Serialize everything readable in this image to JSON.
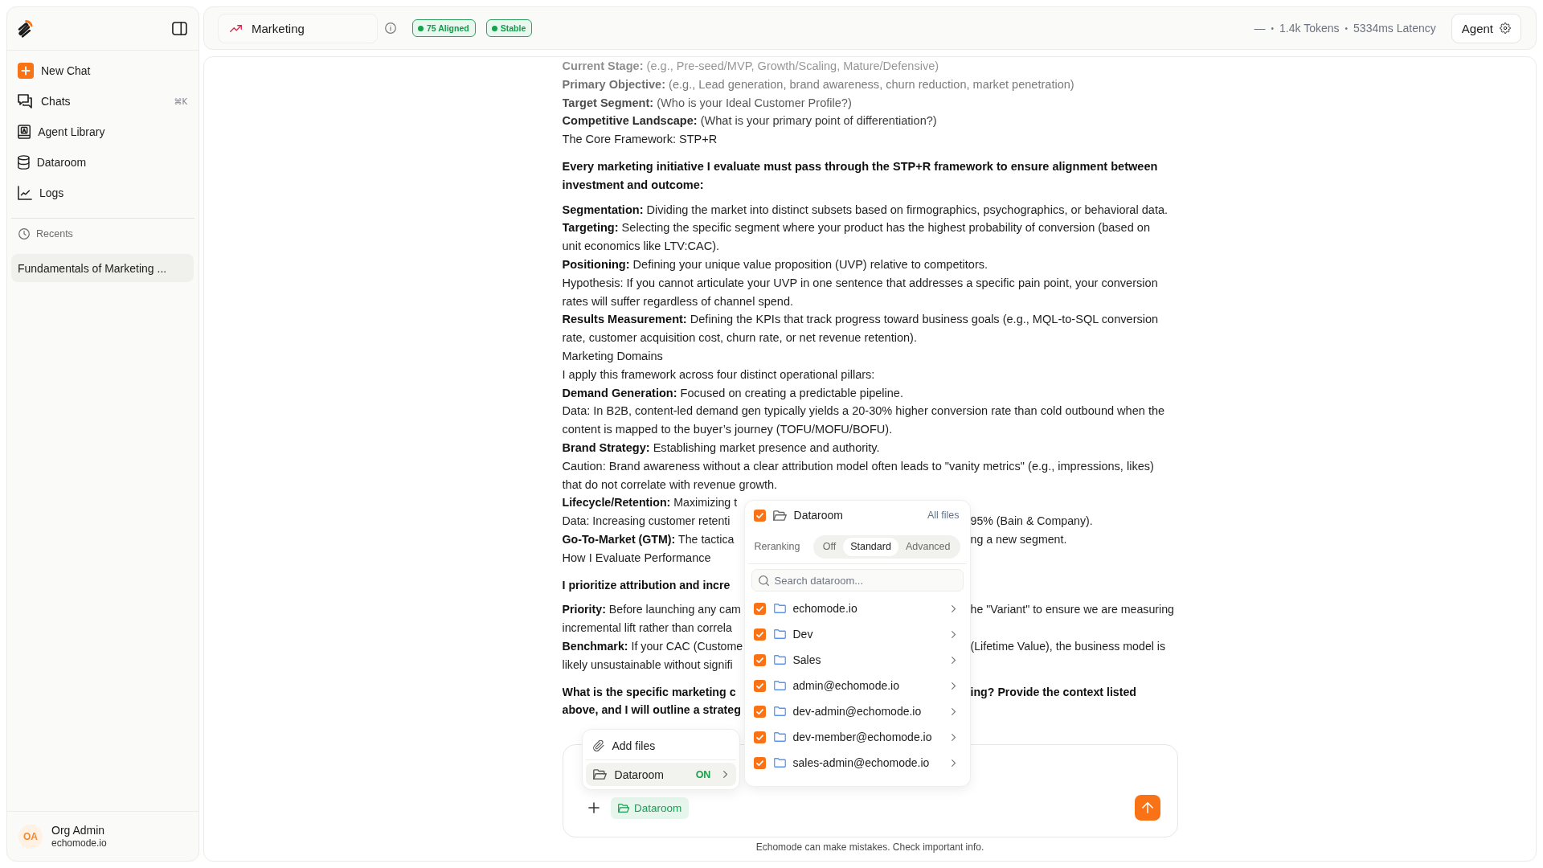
{
  "sidebar": {
    "nav_items": [
      {
        "kind": "new",
        "label": "New Chat"
      },
      {
        "kind": "chats",
        "label": "Chats",
        "shortcut": "⌘K"
      },
      {
        "kind": "library",
        "label": "Agent Library"
      },
      {
        "kind": "dataroom",
        "label": "Dataroom"
      },
      {
        "kind": "logs",
        "label": "Logs"
      }
    ],
    "recents_label": "Recents",
    "recents": [
      {
        "title": "Fundamentals of Marketing ...",
        "selected": true
      }
    ],
    "user": {
      "initials": "OA",
      "name": "Org Admin",
      "email": "echomode.io"
    }
  },
  "topbar": {
    "agent": "Marketing",
    "badges": [
      {
        "label": "75 Aligned"
      },
      {
        "label": "Stable"
      }
    ],
    "stats": [
      {
        "kind": "text",
        "text": "—"
      },
      {
        "kind": "separator",
        "text": "•"
      },
      {
        "kind": "text",
        "text": "1.4k Tokens"
      },
      {
        "kind": "separator",
        "text": "•"
      },
      {
        "kind": "text",
        "text": "5334ms Latency"
      }
    ],
    "agent_button": "Agent"
  },
  "message": {
    "blocks": [
      {
        "kind": "line",
        "text": "**Current Stage:** (e.g., Pre-seed/MVP, Growth/Scaling, Mature/Defensive)"
      },
      {
        "kind": "line",
        "text": "**Primary Objective:** (e.g., Lead generation, brand awareness, churn reduction, market penetration)"
      },
      {
        "kind": "line",
        "text": "**Target Segment:** (Who is your Ideal Customer Profile?)"
      },
      {
        "kind": "line",
        "text": "**Competitive Landscape:** (What is your primary point of differentiation?)"
      },
      {
        "kind": "line",
        "text": "The Core Framework: STP+R"
      },
      {
        "kind": "heading",
        "text": "Every marketing initiative I evaluate must pass through the STP+R framework to ensure alignment between investment and outcome:"
      },
      {
        "kind": "line",
        "text": "**Segmentation:** Dividing the market into distinct subsets based on firmographics, psychographics, or behavioral data."
      },
      {
        "kind": "line",
        "text": "**Targeting:** Selecting the specific segment where your product has the highest probability of conversion (based on unit economics like LTV:CAC)."
      },
      {
        "kind": "line",
        "text": "**Positioning:** Defining your unique value proposition (UVP) relative to competitors."
      },
      {
        "kind": "line",
        "text": "Hypothesis: If you cannot articulate your UVP in one sentence that addresses a specific pain point, your conversion rates will suffer regardless of channel spend."
      },
      {
        "kind": "line",
        "text": "**Results Measurement:** Defining the KPIs that track progress toward business goals (e.g., MQL-to-SQL conversion rate, customer acquisition cost, churn rate, or net revenue retention)."
      },
      {
        "kind": "line",
        "text": "Marketing Domains"
      },
      {
        "kind": "line",
        "text": "I apply this framework across four distinct operational pillars:"
      },
      {
        "kind": "line",
        "text": "**Demand Generation:** Focused on creating a predictable pipeline."
      },
      {
        "kind": "line",
        "text": "Data: In B2B, content-led demand gen typically yields a 20-30% higher conversion rate than cold outbound when the content is mapped to the buyer’s journey (TOFU/MOFU/BOFU)."
      },
      {
        "kind": "line",
        "text": "**Brand Strategy:** Establishing market presence and authority."
      },
      {
        "kind": "line",
        "text": "Caution: Brand awareness without a clear attribution model often leads to \"vanity metrics\" (e.g., impressions, likes) that do not correlate with revenue growth."
      },
      {
        "kind": "split",
        "rows": [
          {
            "left": "**Lifecycle/Retention:** Maximizing t"
          }
        ]
      },
      {
        "kind": "split",
        "rows": [
          {
            "left": "Data: Increasing customer retenti",
            "right": "95% (Bain & Company)."
          }
        ]
      },
      {
        "kind": "split",
        "rows": [
          {
            "left": "**Go-To-Market (GTM):** The tactica",
            "right": "ng a new segment."
          }
        ]
      },
      {
        "kind": "line",
        "text": "How I Evaluate Performance"
      },
      {
        "kind": "heading_split",
        "rows": [
          {
            "left": "I prioritize attribution and incre"
          }
        ]
      },
      {
        "kind": "split",
        "rows": [
          {
            "left": "**Priority:** Before launching any cam",
            "right": "he \"Variant\" to ensure we are measuring"
          },
          {
            "left": "incremental lift rather than correla"
          }
        ]
      },
      {
        "kind": "split",
        "rows": [
          {
            "left": "**Benchmark:** If your CAC (Custome",
            "right": "(Lifetime Value), the business model is"
          },
          {
            "left": "likely unsustainable without signifi"
          }
        ]
      },
      {
        "kind": "heading_split",
        "rows": [
          {
            "left": "What is the specific marketing c",
            "right": "ing? Provide the context listed"
          },
          {
            "left": "above, and I will outline a strateg"
          }
        ]
      }
    ]
  },
  "attach_menu": {
    "items": [
      {
        "kind": "files",
        "label": "Add files",
        "selected": false
      },
      {
        "kind": "dataroom",
        "label": "Dataroom",
        "status": "ON",
        "selected": true
      }
    ]
  },
  "dataroom_panel": {
    "checked": true,
    "title": "Dataroom",
    "link": "All files",
    "reranking_label": "Reranking",
    "reranking_options": [
      {
        "label": "Off",
        "selected": false
      },
      {
        "label": "Standard",
        "selected": true
      },
      {
        "label": "Advanced",
        "selected": false
      }
    ],
    "search": {
      "placeholder": "Search dataroom..."
    },
    "folders": [
      {
        "name": "echomode.io",
        "checked": true
      },
      {
        "name": "Dev",
        "checked": true
      },
      {
        "name": "Sales",
        "checked": true
      },
      {
        "name": "admin@echomode.io",
        "checked": true
      },
      {
        "name": "dev-admin@echomode.io",
        "checked": true
      },
      {
        "name": "dev-member@echomode.io",
        "checked": true
      },
      {
        "name": "sales-admin@echomode.io",
        "checked": true
      }
    ]
  },
  "composer": {
    "chips": [
      {
        "label": "Dataroom"
      }
    ]
  },
  "footer_note": "Echomode can make mistakes. Check important info."
}
